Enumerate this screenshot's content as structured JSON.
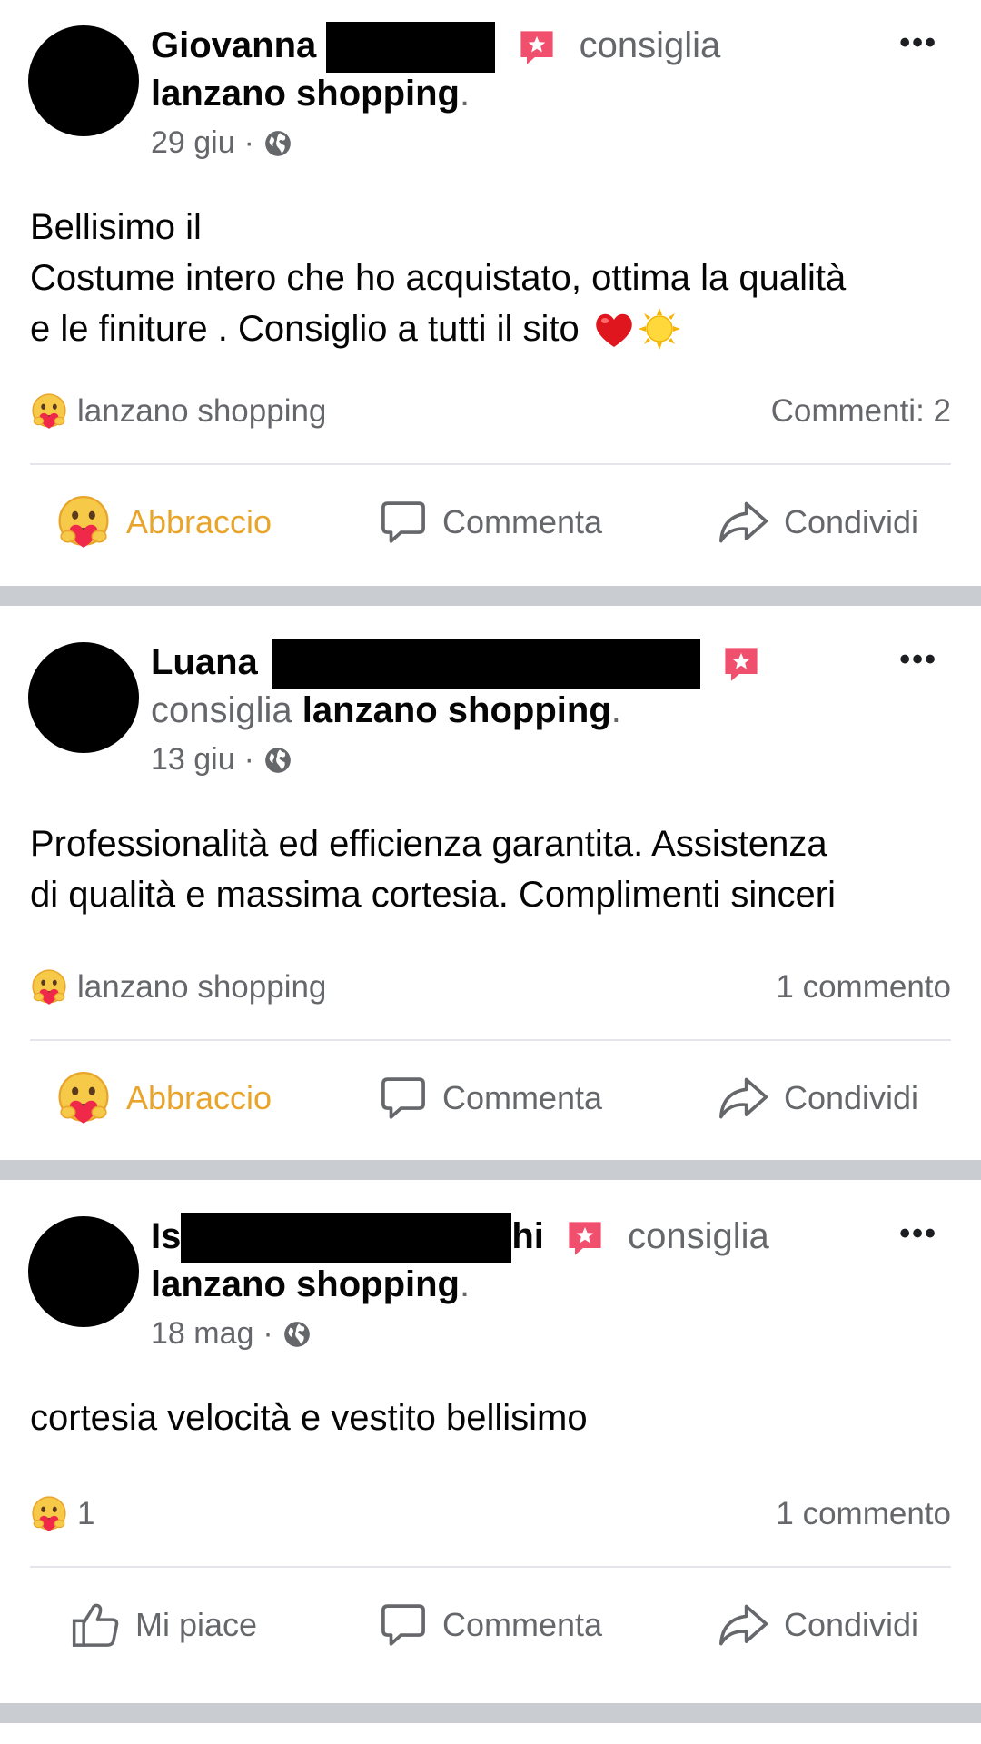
{
  "posts": [
    {
      "author_first": "Giovanna",
      "verb": "consiglia",
      "page": "lanzano shopping",
      "period": ".",
      "date": "29 giu",
      "text_lines": [
        "Bellisimo il",
        "Costume intero che ho acquistato, ottima la qualità",
        "e le finiture . Consiglio a tutti il sito"
      ],
      "text_emojis": [
        "red-heart",
        "sun-face"
      ],
      "reaction_label": "lanzano shopping",
      "comments": "Commenti: 2",
      "actions": {
        "react": "Abbraccio",
        "comment": "Commenta",
        "share": "Condividi"
      }
    },
    {
      "author_first": "Luana",
      "verb": "consiglia",
      "page": "lanzano shopping",
      "period": ".",
      "date": "13 giu",
      "text_lines": [
        "Professionalità ed efficienza garantita. Assistenza",
        "di qualità e massima cortesia. Complimenti sinceri"
      ],
      "reaction_label": "lanzano shopping",
      "comments": "1 commento",
      "actions": {
        "react": "Abbraccio",
        "comment": "Commenta",
        "share": "Condividi"
      }
    },
    {
      "author_first": "Is",
      "author_last": "hi",
      "verb": "consiglia",
      "page": "lanzano shopping",
      "period": ".",
      "date": "18 mag",
      "text_lines": [
        "cortesia velocità e vestito bellisimo"
      ],
      "reaction_label": "1",
      "comments": "1 commento",
      "actions": {
        "react": "Mi piace",
        "comment": "Commenta",
        "share": "Condividi"
      }
    }
  ],
  "more_label": "•••",
  "dot_sep": "·",
  "colors": {
    "care_reaction": "#e9a52b",
    "recommend_badge": "#f0506e",
    "divider": "#c9ccd1",
    "secondary_text": "#65676b"
  },
  "icons": [
    "recommend-badge-icon",
    "globe-icon",
    "care-emoji-icon",
    "comment-icon",
    "share-icon",
    "like-icon",
    "more-icon"
  ]
}
